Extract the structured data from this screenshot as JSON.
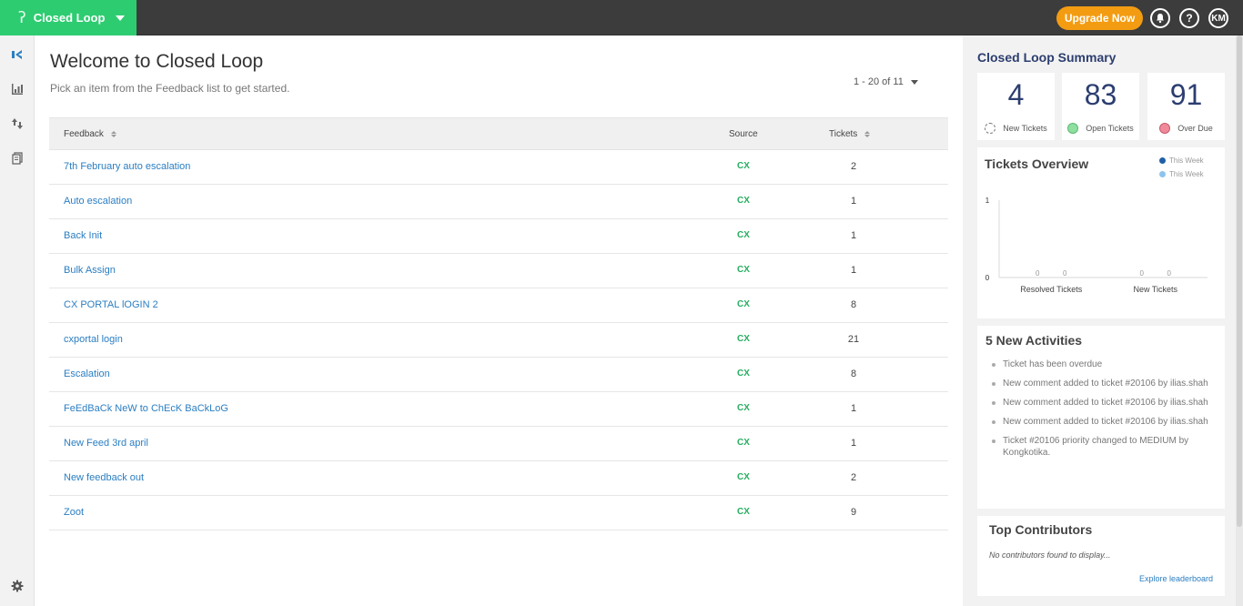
{
  "app": {
    "name": "Closed Loop",
    "upgrade_label": "Upgrade Now",
    "help_label": "?",
    "user_initials": "KM"
  },
  "icons": {
    "brand": "closed-loop-logo-icon",
    "rail": [
      "closed-loop-icon",
      "bar-chart-icon",
      "transfer-arrows-icon",
      "documents-icon",
      "gear-icon"
    ],
    "top": [
      "bell-icon",
      "help-icon",
      "avatar"
    ]
  },
  "main": {
    "title": "Welcome to Closed Loop",
    "subtitle": "Pick an item from the Feedback list to get started.",
    "pager": "1 - 20 of 11",
    "table": {
      "headers": {
        "feedback": "Feedback",
        "source": "Source",
        "tickets": "Tickets"
      },
      "rows": [
        {
          "feedback": "7th February auto escalation",
          "source": "CX",
          "tickets": "2"
        },
        {
          "feedback": "Auto escalation",
          "source": "CX",
          "tickets": "1"
        },
        {
          "feedback": "Back Init",
          "source": "CX",
          "tickets": "1"
        },
        {
          "feedback": "Bulk Assign",
          "source": "CX",
          "tickets": "1"
        },
        {
          "feedback": "CX PORTAL lOGIN 2",
          "source": "CX",
          "tickets": "8"
        },
        {
          "feedback": "cxportal login",
          "source": "CX",
          "tickets": "21"
        },
        {
          "feedback": "Escalation",
          "source": "CX",
          "tickets": "8"
        },
        {
          "feedback": "FeEdBaCk NeW to ChEcK BaCkLoG",
          "source": "CX",
          "tickets": "1"
        },
        {
          "feedback": "New Feed 3rd april",
          "source": "CX",
          "tickets": "1"
        },
        {
          "feedback": "New feedback out",
          "source": "CX",
          "tickets": "2"
        },
        {
          "feedback": "Zoot",
          "source": "CX",
          "tickets": "9"
        }
      ]
    }
  },
  "summary": {
    "title": "Closed Loop Summary",
    "stats": [
      {
        "value": "4",
        "label": "New Tickets",
        "color": "#ffffff"
      },
      {
        "value": "83",
        "label": "Open Tickets",
        "color": "#8fe0a0"
      },
      {
        "value": "91",
        "label": "Over Due",
        "color": "#f08a9a"
      }
    ]
  },
  "overview": {
    "title": "Tickets Overview",
    "legend": [
      {
        "label": "This Week",
        "color": "#1f5fa8"
      },
      {
        "label": "This Week",
        "color": "#8ec3ee"
      }
    ]
  },
  "chart_data": {
    "type": "bar",
    "categories": [
      "Resolved Tickets",
      "New Tickets"
    ],
    "series": [
      {
        "values": [
          0,
          0
        ]
      },
      {
        "values": [
          0,
          0
        ]
      }
    ],
    "value_labels": [
      "0",
      "0",
      "0",
      "0"
    ],
    "y_ticks": [
      "0",
      "1"
    ],
    "ylim": [
      0,
      1
    ]
  },
  "activities": {
    "title": "5 New Activities",
    "items": [
      "Ticket has been overdue",
      "New comment added to ticket #20106 by ilias.shah",
      "New comment added to ticket #20106 by ilias.shah",
      "New comment added to ticket #20106 by ilias.shah",
      "Ticket #20106 priority changed to MEDIUM by Kongkotika."
    ]
  },
  "contributors": {
    "title": "Top Contributors",
    "empty_text": "No contributors found to display...",
    "link": "Explore leaderboard"
  }
}
